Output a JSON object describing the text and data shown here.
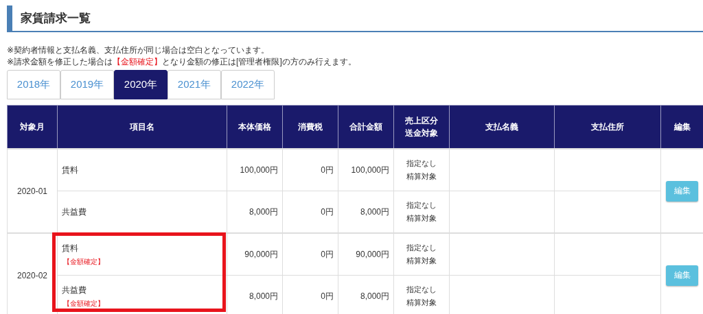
{
  "title": "家賃請求一覧",
  "notes": [
    [
      {
        "text": "※契約者情報と支払名義、支払住所が同じ場合は空白となっています。",
        "emphasis": false
      }
    ],
    [
      {
        "text": "※請求金額を修正した場合は",
        "emphasis": false
      },
      {
        "text": "【金額確定】",
        "emphasis": true
      },
      {
        "text": "となり金額の修正は[管理者権限]の方のみ行えます。",
        "emphasis": false
      }
    ]
  ],
  "tabs": [
    {
      "label": "2018年",
      "selected": false
    },
    {
      "label": "2019年",
      "selected": false
    },
    {
      "label": "2020年",
      "selected": true
    },
    {
      "label": "2021年",
      "selected": false
    },
    {
      "label": "2022年",
      "selected": false
    }
  ],
  "table": {
    "columns": [
      [
        "対象月"
      ],
      [
        "項目名"
      ],
      [
        "本体価格"
      ],
      [
        "消費税"
      ],
      [
        "合計金額"
      ],
      [
        "売上区分",
        "送金対象"
      ],
      [
        "支払名義"
      ],
      [
        "支払住所"
      ],
      [
        "編集"
      ]
    ],
    "months": [
      {
        "month": "2020-01",
        "highlighted": false,
        "edit_button": "編集",
        "items": [
          {
            "name": "賃料",
            "price": "100,000円",
            "tax": "0円",
            "total": "100,000円",
            "category": [
              "指定なし",
              "精算対象"
            ]
          },
          {
            "name": "共益費",
            "price": "8,000円",
            "tax": "0円",
            "total": "8,000円",
            "category": [
              "指定なし",
              "精算対象"
            ]
          }
        ]
      },
      {
        "month": "2020-02",
        "highlighted": true,
        "edit_button": "編集",
        "items": [
          {
            "name": "賃料",
            "badge": "【金額確定】",
            "price": "90,000円",
            "tax": "0円",
            "total": "90,000円",
            "category": [
              "指定なし",
              "精算対象"
            ]
          },
          {
            "name": "共益費",
            "badge": "【金額確定】",
            "price": "8,000円",
            "tax": "0円",
            "total": "8,000円",
            "category": [
              "指定なし",
              "精算対象"
            ]
          }
        ]
      }
    ]
  }
}
